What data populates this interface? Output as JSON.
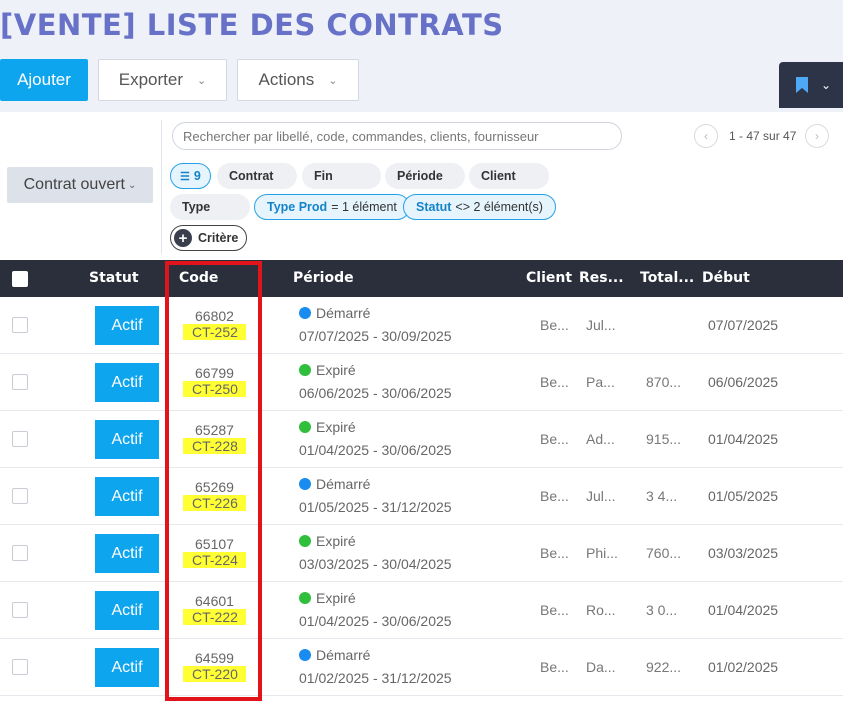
{
  "page": {
    "title": "[VENTE] LISTE DES CONTRATS"
  },
  "toolbar": {
    "add_label": "Ajouter",
    "export_label": "Exporter",
    "actions_label": "Actions"
  },
  "filters": {
    "preset_label": "Contrat ouvert",
    "search_placeholder": "Rechercher par libellé, code, commandes, clients, fournisseur",
    "pagination": "1 - 47 sur 47",
    "filter_count": "9",
    "chips": [
      "Contrat",
      "Fin",
      "Période",
      "Client",
      "Type"
    ],
    "active_chips": [
      {
        "field": "Type Prod",
        "rest": "= 1 élément"
      },
      {
        "field": "Statut",
        "rest": "<> 2 élément(s)"
      }
    ],
    "add_criteria_label": "Critère"
  },
  "table": {
    "headers": [
      "Statut",
      "Code",
      "Période",
      "Client",
      "Res...",
      "Total...",
      "Début"
    ],
    "rows": [
      {
        "status": "Actif",
        "code": "66802",
        "ref": "CT-252",
        "state": "Démarré",
        "period": "07/07/2025 - 30/09/2025",
        "client": "Be...",
        "resp": "Jul...",
        "total": "",
        "start": "07/07/2025"
      },
      {
        "status": "Actif",
        "code": "66799",
        "ref": "CT-250",
        "state": "Expiré",
        "period": "06/06/2025 - 30/06/2025",
        "client": "Be...",
        "resp": "Pa...",
        "total": "870...",
        "start": "06/06/2025"
      },
      {
        "status": "Actif",
        "code": "65287",
        "ref": "CT-228",
        "state": "Expiré",
        "period": "01/04/2025 - 30/06/2025",
        "client": "Be...",
        "resp": "Ad...",
        "total": "915...",
        "start": "01/04/2025"
      },
      {
        "status": "Actif",
        "code": "65269",
        "ref": "CT-226",
        "state": "Démarré",
        "period": "01/05/2025 - 31/12/2025",
        "client": "Be...",
        "resp": "Jul...",
        "total": "3 4...",
        "start": "01/05/2025"
      },
      {
        "status": "Actif",
        "code": "65107",
        "ref": "CT-224",
        "state": "Expiré",
        "period": "03/03/2025 - 30/04/2025",
        "client": "Be...",
        "resp": "Phi...",
        "total": "760...",
        "start": "03/03/2025"
      },
      {
        "status": "Actif",
        "code": "64601",
        "ref": "CT-222",
        "state": "Expiré",
        "period": "01/04/2025 - 30/06/2025",
        "client": "Be...",
        "resp": "Ro...",
        "total": "3 0...",
        "start": "01/04/2025"
      },
      {
        "status": "Actif",
        "code": "64599",
        "ref": "CT-220",
        "state": "Démarré",
        "period": "01/02/2025 - 31/12/2025",
        "client": "Be...",
        "resp": "Da...",
        "total": "922...",
        "start": "01/02/2025"
      }
    ]
  },
  "colors": {
    "accent": "#0ea5ef",
    "started": "#1a8cf0",
    "expired": "#2fbf3c",
    "highlight": "#ffff33",
    "annotation": "#e0141a"
  }
}
